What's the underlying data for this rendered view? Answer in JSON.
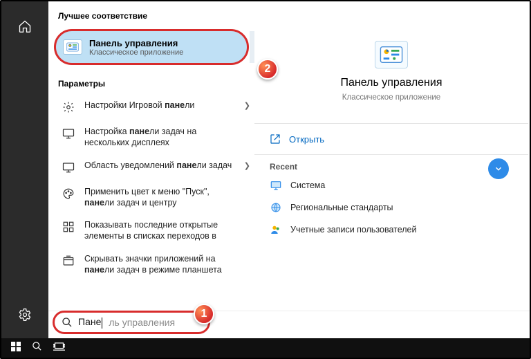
{
  "sections": {
    "best_match": "Лучшее соответствие",
    "parameters": "Параметры",
    "recent": "Recent"
  },
  "best": {
    "title": "Панель управления",
    "subtitle": "Классическое приложение"
  },
  "params": [
    {
      "icon": "gear",
      "html": "Настройки Игровой <b>пане</b>ли",
      "arrow": true
    },
    {
      "icon": "monitor",
      "html": "Настройка <b>пане</b>ли задач на нескольких дисплеях",
      "arrow": false
    },
    {
      "icon": "monitor",
      "html": "Область уведомлений <b>пане</b>ли задач",
      "arrow": true
    },
    {
      "icon": "palette",
      "html": "Применить цвет к меню \"Пуск\", <b>пане</b>ли задач и центру",
      "arrow": false
    },
    {
      "icon": "list",
      "html": "Показывать последние открытые элементы в списках переходов в",
      "arrow": false
    },
    {
      "icon": "tablet",
      "html": "Скрывать значки приложений на <b>пане</b>ли задач в режиме планшета",
      "arrow": false
    }
  ],
  "preview": {
    "title": "Панель управления",
    "subtitle": "Классическое приложение",
    "open": "Открыть",
    "recent": [
      {
        "icon": "screen",
        "label": "Система"
      },
      {
        "icon": "globe",
        "label": "Региональные стандарты"
      },
      {
        "icon": "users",
        "label": "Учетные записи пользователей"
      }
    ]
  },
  "search": {
    "typed": "Пане",
    "ghost": "ль управления"
  },
  "badges": {
    "one": "1",
    "two": "2"
  }
}
